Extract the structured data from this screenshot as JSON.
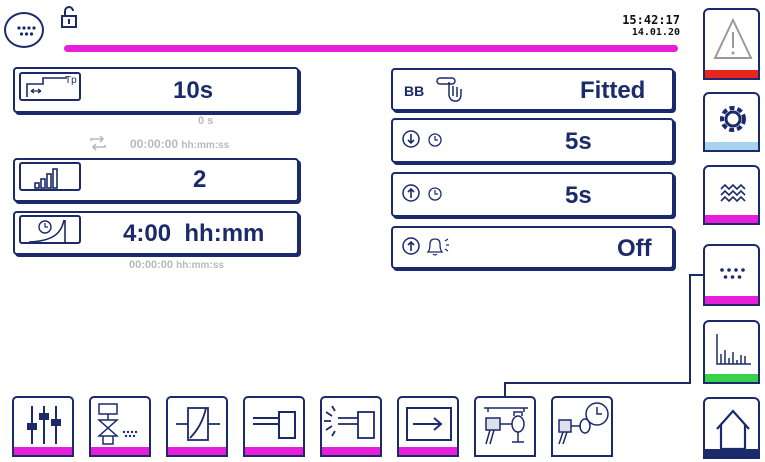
{
  "header": {
    "time": "15:42:17",
    "date": "14.01.20",
    "menu_icon": "dots-menu-icon",
    "lock_icon": "unlocked-padlock-icon",
    "progress_color": "#e81fd8"
  },
  "left_params": {
    "pulse_time": {
      "icon": "pulse-time-icon",
      "value": "10s",
      "sub_value": "0 s"
    },
    "cycle_timer": {
      "icon": "repeat-icon",
      "value": "00:00:00",
      "unit": "hh:mm:ss"
    },
    "level": {
      "icon": "signal-level-icon",
      "value": "2"
    },
    "interval": {
      "icon": "timer-curve-icon",
      "value": "4:00",
      "unit": "hh:mm",
      "sub_value": "00:00:00",
      "sub_unit": "hh:mm:ss"
    }
  },
  "right_params": {
    "bb": {
      "label": "BB",
      "icon": "push-button-icon",
      "value": "Fitted"
    },
    "down_delay": {
      "icon": "down-delay-icon",
      "value": "5s"
    },
    "up_delay": {
      "icon": "up-delay-icon",
      "value": "5s"
    },
    "alarm": {
      "icon": "up-alarm-bell-icon",
      "value": "Off"
    }
  },
  "side_tabs": [
    {
      "icon": "warning-icon",
      "stripe": "#e8251c"
    },
    {
      "icon": "gear-icon",
      "stripe": "#a9d2ef"
    },
    {
      "icon": "waves-icon",
      "stripe": "#e81fd8"
    },
    {
      "icon": "dots-panel-icon",
      "stripe": "#e81fd8"
    },
    {
      "icon": "bar-chart-icon",
      "stripe": "#39d24a"
    },
    {
      "icon": "home-icon",
      "stripe": "#1b2a6b"
    }
  ],
  "bottom_tabs": [
    {
      "icon": "sliders-icon"
    },
    {
      "icon": "valve-dots-icon"
    },
    {
      "icon": "box-switch-icon"
    },
    {
      "icon": "piston-icon"
    },
    {
      "icon": "piston-flash-icon"
    },
    {
      "icon": "arrow-box-icon"
    },
    {
      "icon": "valve-assembly-icon"
    },
    {
      "icon": "valve-clock-icon"
    }
  ],
  "accent_color": "#1b2a6b"
}
